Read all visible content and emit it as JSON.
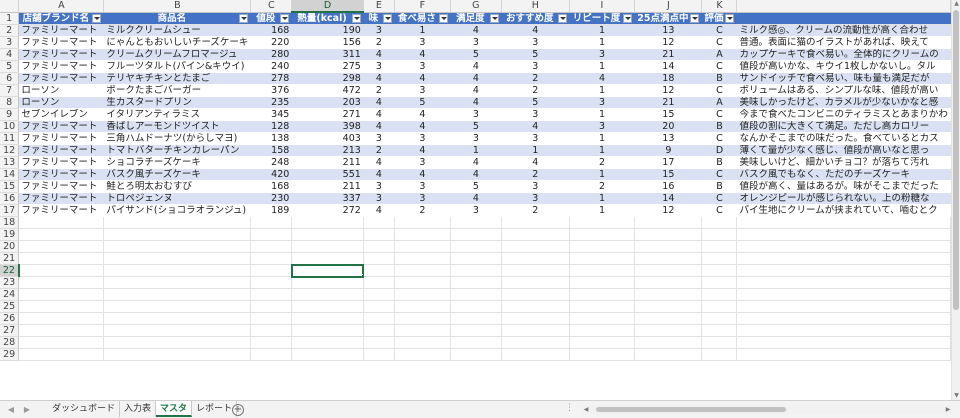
{
  "columns": [
    "A",
    "B",
    "C",
    "D",
    "E",
    "F",
    "G",
    "H",
    "I",
    "J",
    "K",
    ""
  ],
  "selected_column": "D",
  "selected_row": 22,
  "table_headers": [
    "店舗ブランド名",
    "商品名",
    "値段",
    "熱量(kcal)",
    "味",
    "食べ易さ",
    "満足度",
    "おすすめ度",
    "リピート度",
    "25点満点中",
    "評価",
    ""
  ],
  "rows": [
    [
      "ファミリーマート",
      "ミルククリームシュー",
      "168",
      "190",
      "3",
      "1",
      "4",
      "4",
      "1",
      "13",
      "C",
      "ミルク感◎、クリームの流動性が高く合わせ"
    ],
    [
      "ファミリーマート",
      "にゃんともおいしいチーズケーキ",
      "220",
      "156",
      "2",
      "3",
      "3",
      "3",
      "1",
      "12",
      "C",
      "普通。表面に猫のイラストがあれば、映えて"
    ],
    [
      "ファミリーマート",
      "クリームクリームフロマージュ",
      "280",
      "311",
      "4",
      "4",
      "5",
      "5",
      "3",
      "21",
      "A",
      "カップケーキで食べ易い。全体的にクリームの"
    ],
    [
      "ファミリーマート",
      "フルーツタルト(パイン&キウイ)",
      "240",
      "275",
      "3",
      "3",
      "4",
      "3",
      "1",
      "14",
      "C",
      "値段が高いかな、キウイ1枚しかないし。タル"
    ],
    [
      "ファミリーマート",
      "テリヤキチキンとたまご",
      "278",
      "298",
      "4",
      "4",
      "4",
      "2",
      "4",
      "18",
      "B",
      "サンドイッチで食べ易い、味も量も満足だが"
    ],
    [
      "ローソン",
      "ポークたまごバーガー",
      "376",
      "472",
      "2",
      "3",
      "4",
      "2",
      "1",
      "12",
      "C",
      "ボリュームはある、シンプルな味、値段が高い"
    ],
    [
      "ローソン",
      "生カスタードプリン",
      "235",
      "203",
      "4",
      "5",
      "4",
      "5",
      "3",
      "21",
      "A",
      "美味しかったけど、カラメルが少ないかなと感"
    ],
    [
      "セブンイレブン",
      "イタリアンティラミス",
      "345",
      "271",
      "4",
      "4",
      "3",
      "3",
      "1",
      "15",
      "C",
      "今まで食べたコンビニのティラミスとあまりかわ"
    ],
    [
      "ファミリーマート",
      "香ばしアーモンドツイスト",
      "128",
      "398",
      "4",
      "4",
      "5",
      "4",
      "3",
      "20",
      "B",
      "値段の割に大きくて満足。ただし高カロリー"
    ],
    [
      "ファミリーマート",
      "三角ハムドーナツ(からしマヨ)",
      "138",
      "403",
      "3",
      "3",
      "3",
      "3",
      "1",
      "13",
      "C",
      "なんかそこまでの味だった。食べているとカス"
    ],
    [
      "ファミリーマート",
      "トマトバターチキンカレーパン",
      "158",
      "213",
      "2",
      "4",
      "1",
      "1",
      "1",
      "9",
      "D",
      "薄くて量が少なく感じ、値段が高いなと思っ"
    ],
    [
      "ファミリーマート",
      "ショコラチーズケーキ",
      "248",
      "211",
      "4",
      "3",
      "4",
      "4",
      "2",
      "17",
      "B",
      "美味しいけど、細かいチョコ？が落ちて汚れ"
    ],
    [
      "ファミリーマート",
      "バスク風チーズケーキ",
      "420",
      "551",
      "4",
      "4",
      "4",
      "2",
      "1",
      "15",
      "C",
      "バスク風でもなく、ただのチーズケーキ"
    ],
    [
      "ファミリーマート",
      "鮭とろ明太おむすび",
      "168",
      "211",
      "3",
      "3",
      "5",
      "3",
      "2",
      "16",
      "B",
      "値段が高く、量はあるが。味がそこまでだった"
    ],
    [
      "ファミリーマート",
      "トロペジェンヌ",
      "230",
      "337",
      "3",
      "3",
      "4",
      "3",
      "1",
      "14",
      "C",
      "オレンジピールが感じられない。上の粉糖な"
    ],
    [
      "ファミリーマート",
      "パイサンド(ショコラオランジュ)",
      "189",
      "272",
      "4",
      "2",
      "3",
      "2",
      "1",
      "12",
      "C",
      "パイ生地にクリームが挟まれていて、嚙むとク"
    ]
  ],
  "total_rows": 29,
  "sheet_tabs": [
    "ダッシュボード",
    "入力表",
    "マスタ",
    "レポート"
  ],
  "active_tab": "マスタ",
  "add_sheet_label": "+",
  "nav_prev": "◀",
  "nav_next": "▶",
  "more_dots": "⋮",
  "colors": {
    "table_header": "#4472c4",
    "band": "#d9e1f2",
    "accent": "#217346"
  },
  "icons": {
    "filter": "filter-dropdown-icon",
    "add": "add-sheet-icon"
  }
}
